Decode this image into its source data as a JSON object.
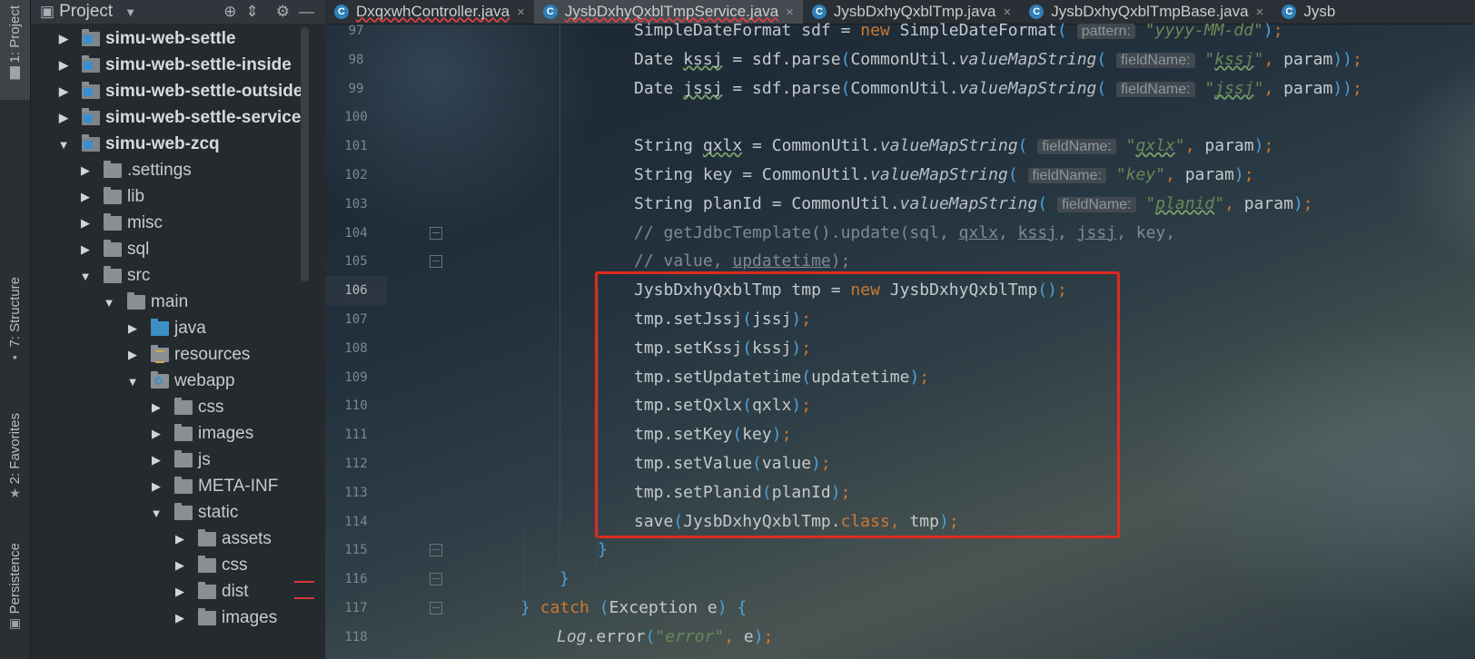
{
  "toolstrip": {
    "tabs": [
      "1: Project",
      "7: Structure",
      "2: Favorites",
      "Persistence"
    ]
  },
  "project_panel": {
    "title": "Project",
    "tree": [
      {
        "label": "simu-web-settle",
        "indent": 0,
        "arrow": "▶",
        "icon": "module",
        "bold": true
      },
      {
        "label": "simu-web-settle-inside",
        "indent": 0,
        "arrow": "▶",
        "icon": "module",
        "bold": true
      },
      {
        "label": "simu-web-settle-outside",
        "indent": 0,
        "arrow": "▶",
        "icon": "module",
        "bold": true
      },
      {
        "label": "simu-web-settle-service",
        "indent": 0,
        "arrow": "▶",
        "icon": "module",
        "bold": true
      },
      {
        "label": "simu-web-zcq",
        "indent": 0,
        "arrow": "▼",
        "icon": "module",
        "bold": true
      },
      {
        "label": ".settings",
        "indent": 1,
        "arrow": "▶",
        "icon": "folder"
      },
      {
        "label": "lib",
        "indent": 1,
        "arrow": "▶",
        "icon": "folder"
      },
      {
        "label": "misc",
        "indent": 1,
        "arrow": "▶",
        "icon": "folder"
      },
      {
        "label": "sql",
        "indent": 1,
        "arrow": "▶",
        "icon": "folder"
      },
      {
        "label": "src",
        "indent": 1,
        "arrow": "▼",
        "icon": "folder"
      },
      {
        "label": "main",
        "indent": 2,
        "arrow": "▼",
        "icon": "folder"
      },
      {
        "label": "java",
        "indent": 3,
        "arrow": "▶",
        "icon": "folder-blue"
      },
      {
        "label": "resources",
        "indent": 3,
        "arrow": "▶",
        "icon": "folder-resources"
      },
      {
        "label": "webapp",
        "indent": 3,
        "arrow": "▼",
        "icon": "folder-web"
      },
      {
        "label": "css",
        "indent": 4,
        "arrow": "▶",
        "icon": "folder"
      },
      {
        "label": "images",
        "indent": 4,
        "arrow": "▶",
        "icon": "folder"
      },
      {
        "label": "js",
        "indent": 4,
        "arrow": "▶",
        "icon": "folder"
      },
      {
        "label": "META-INF",
        "indent": 4,
        "arrow": "▶",
        "icon": "folder"
      },
      {
        "label": "static",
        "indent": 4,
        "arrow": "▼",
        "icon": "folder"
      },
      {
        "label": "assets",
        "indent": 5,
        "arrow": "▶",
        "icon": "folder"
      },
      {
        "label": "css",
        "indent": 5,
        "arrow": "▶",
        "icon": "folder"
      },
      {
        "label": "dist",
        "indent": 5,
        "arrow": "▶",
        "icon": "folder"
      },
      {
        "label": "images",
        "indent": 5,
        "arrow": "▶",
        "icon": "folder"
      }
    ]
  },
  "editor": {
    "tabs": [
      {
        "label": "DxqxwhController.java",
        "active": false,
        "error": true
      },
      {
        "label": "JysbDxhyQxblTmpService.java",
        "active": true,
        "error": true
      },
      {
        "label": "JysbDxhyQxblTmp.java",
        "active": false,
        "error": false
      },
      {
        "label": "JysbDxhyQxblTmpBase.java",
        "active": false,
        "error": false
      },
      {
        "label": "Jysb",
        "active": false,
        "error": false
      }
    ],
    "line_numbers": [
      "97",
      "98",
      "99",
      "100",
      "101",
      "102",
      "103",
      "104",
      "105",
      "106",
      "107",
      "108",
      "109",
      "110",
      "111",
      "112",
      "113",
      "114",
      "115",
      "116",
      "117",
      "118"
    ],
    "current_line": "106",
    "hint_label": "fieldName:",
    "lines": [
      {
        "t": "SimpleDateFormat sdf = new SimpleDateFormat( pattern: \"yyyy-MM-dd\");"
      },
      {
        "t": "Date kssj = sdf.parse(CommonUtil.valueMapString( fieldName: \"kssj\", param));"
      },
      {
        "t": "Date jssj = sdf.parse(CommonUtil.valueMapString( fieldName: \"jssj\", param));"
      },
      {
        "t": ""
      },
      {
        "t": "String qxlx = CommonUtil.valueMapString( fieldName: \"qxlx\", param);"
      },
      {
        "t": "String key = CommonUtil.valueMapString( fieldName: \"key\", param);"
      },
      {
        "t": "String planId = CommonUtil.valueMapString( fieldName: \"planid\", param);"
      },
      {
        "t": "// getJdbcTemplate().update(sql, qxlx, kssj, jssj, key,"
      },
      {
        "t": "// value, updatetime);"
      },
      {
        "t": "JysbDxhyQxblTmp tmp = new JysbDxhyQxblTmp();"
      },
      {
        "t": "tmp.setJssj(jssj);"
      },
      {
        "t": "tmp.setKssj(kssj);"
      },
      {
        "t": "tmp.setUpdatetime(updatetime);"
      },
      {
        "t": "tmp.setQxlx(qxlx);"
      },
      {
        "t": "tmp.setKey(key);"
      },
      {
        "t": "tmp.setValue(value);"
      },
      {
        "t": "tmp.setPlanid(planId);"
      },
      {
        "t": "save(JysbDxhyQxblTmp.class, tmp);"
      },
      {
        "t": "}"
      },
      {
        "t": "}"
      },
      {
        "t": "} catch (Exception e) {"
      },
      {
        "t": "Log.error(\"error\", e);"
      }
    ]
  },
  "colors": {
    "keyword": "#cc7832",
    "string": "#6a8759",
    "comment": "#7f8a93",
    "paren": "#4fa0d8",
    "highlight_box": "#e02a1f"
  }
}
